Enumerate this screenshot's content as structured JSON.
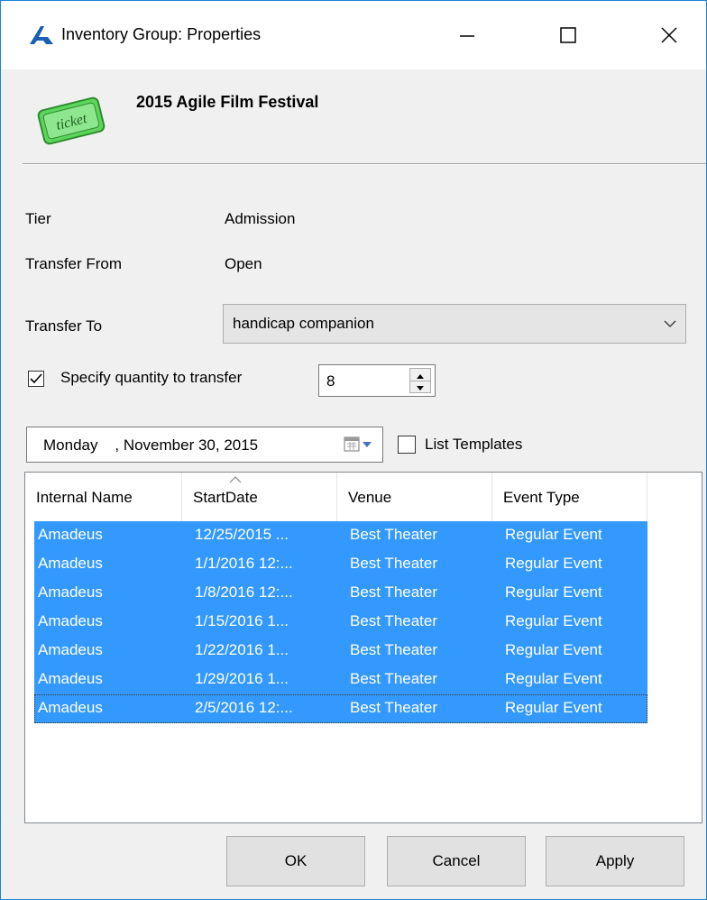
{
  "window": {
    "title": "Inventory Group: Properties",
    "accent": "#1883d7"
  },
  "header": {
    "title": "2015 Agile Film Festival",
    "icon": "ticket-icon",
    "icon_text": "ticket",
    "icon_color": "#5cd65c"
  },
  "fields": {
    "tier_label": "Tier",
    "tier_value": "Admission",
    "transfer_from_label": "Transfer From",
    "transfer_from_value": "Open",
    "transfer_to_label": "Transfer To",
    "transfer_to_value": "handicap companion"
  },
  "quantity": {
    "checkbox_label": "Specify quantity to transfer",
    "checked": true,
    "value": "8"
  },
  "date": {
    "text": "Monday    , November 30, 2015"
  },
  "templates": {
    "label": "List Templates",
    "checked": false
  },
  "list": {
    "selection_color": "#3399ff",
    "columns": [
      "Internal Name",
      "StartDate",
      "Venue",
      "Event Type"
    ],
    "sorted_column": "StartDate",
    "rows": [
      [
        "Amadeus",
        "12/25/2015 ...",
        "Best Theater",
        "Regular Event"
      ],
      [
        "Amadeus",
        "1/1/2016 12:...",
        "Best Theater",
        "Regular Event"
      ],
      [
        "Amadeus",
        "1/8/2016 12:...",
        "Best Theater",
        "Regular Event"
      ],
      [
        "Amadeus",
        "1/15/2016 1...",
        "Best Theater",
        "Regular Event"
      ],
      [
        "Amadeus",
        "1/22/2016 1...",
        "Best Theater",
        "Regular Event"
      ],
      [
        "Amadeus",
        "1/29/2016 1...",
        "Best Theater",
        "Regular Event"
      ],
      [
        "Amadeus",
        "2/5/2016 12:...",
        "Best Theater",
        "Regular Event"
      ]
    ]
  },
  "buttons": {
    "ok": "OK",
    "cancel": "Cancel",
    "apply": "Apply"
  }
}
